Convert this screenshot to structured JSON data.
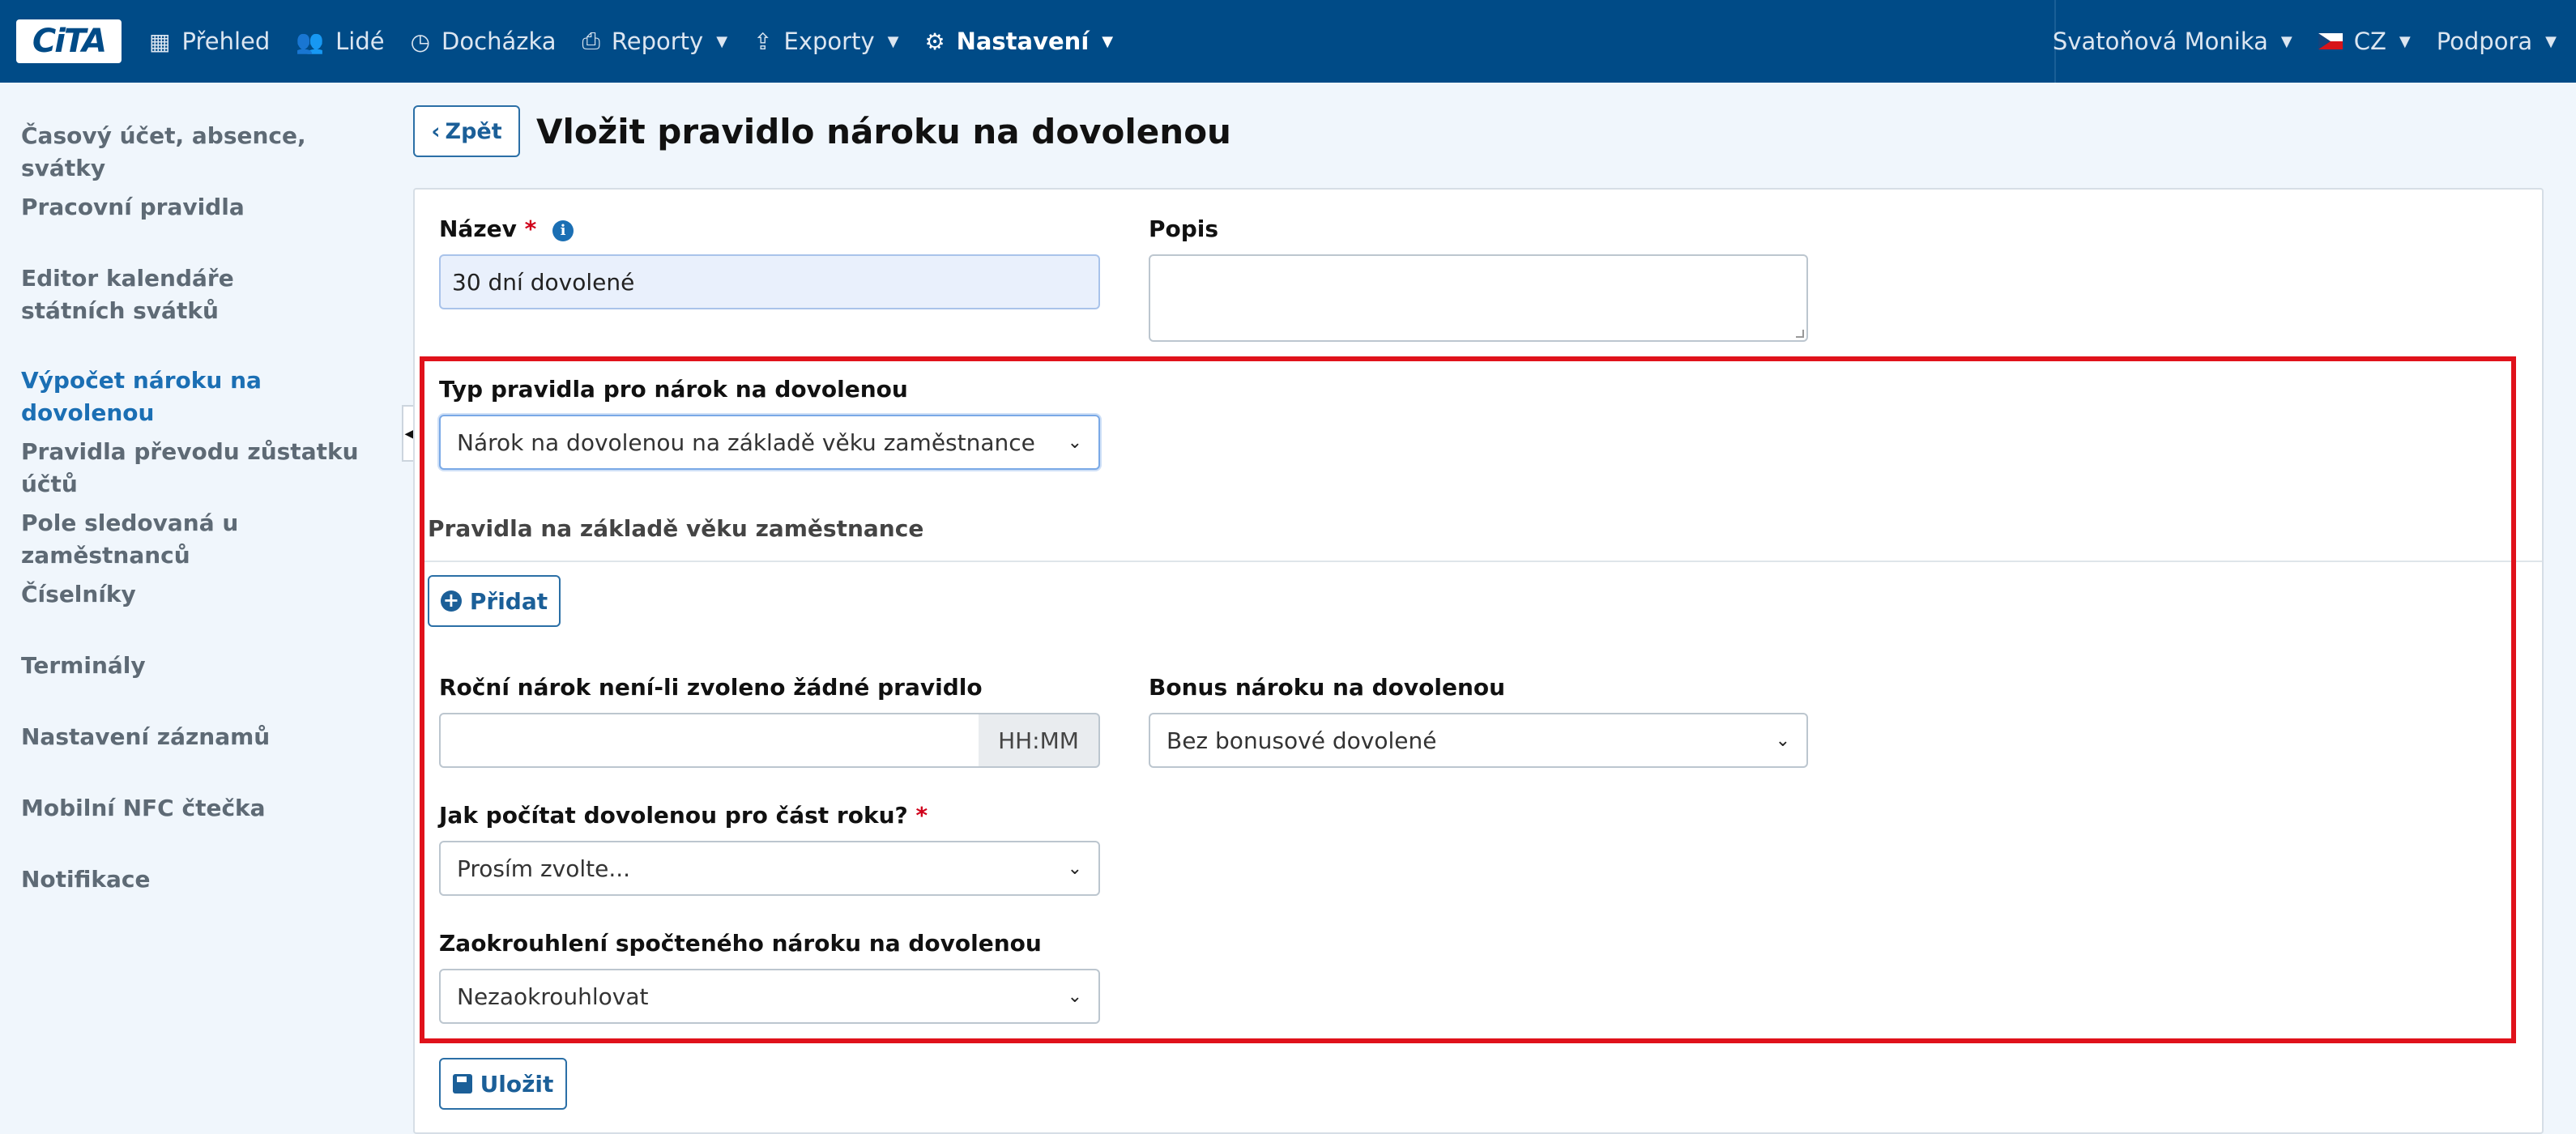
{
  "brand": {
    "logo_text": "CiTA"
  },
  "nav": {
    "items": [
      {
        "label": "Přehled",
        "icon": "grid-icon"
      },
      {
        "label": "Lidé",
        "icon": "users-icon"
      },
      {
        "label": "Docházka",
        "icon": "clock-icon"
      },
      {
        "label": "Reporty",
        "icon": "print-icon"
      },
      {
        "label": "Exporty",
        "icon": "export-icon"
      },
      {
        "label": "Nastavení",
        "icon": "gear-icon"
      }
    ],
    "user": "Svatoňová Monika",
    "language": "CZ",
    "support": "Podpora"
  },
  "sidebar": {
    "items": [
      {
        "label": "Časový účet, absence, svátky"
      },
      {
        "label": "Pracovní pravidla"
      },
      {
        "label": "Editor kalendáře státních svátků"
      },
      {
        "label": "Výpočet nároku na dovolenou",
        "active": true
      },
      {
        "label": "Pravidla převodu zůstatku účtů"
      },
      {
        "label": "Pole sledovaná u zaměstnanců"
      },
      {
        "label": "Číselníky"
      },
      {
        "label": "Terminály"
      },
      {
        "label": "Nastavení záznamů"
      },
      {
        "label": "Mobilní NFC čtečka"
      },
      {
        "label": "Notifikace"
      }
    ]
  },
  "page": {
    "back_label": "Zpět",
    "title": "Vložit pravidlo nároku na dovolenou"
  },
  "form": {
    "name_label": "Název",
    "name_required": "*",
    "name_value": "30 dní dovolené",
    "description_label": "Popis",
    "description_value": "",
    "rule_type_label": "Typ pravidla pro nárok na dovolenou",
    "rule_type_value": "Nárok na dovolenou na základě věku zaměstnance",
    "age_rules_title": "Pravidla na základě věku zaměstnance",
    "add_label": "Přidat",
    "annual_label": "Roční nárok není-li zvoleno žádné pravidlo",
    "annual_value": "",
    "annual_addon": "HH:MM",
    "bonus_label": "Bonus nároku na dovolenou",
    "bonus_value": "Bez bonusové dovolené",
    "partial_label": "Jak počítat dovolenou pro část roku?",
    "partial_required": "*",
    "partial_value": "Prosím zvolte...",
    "rounding_label": "Zaokrouhlení spočteného nároku na dovolenou",
    "rounding_value": "Nezaokrouhlovat",
    "save_label": "Uložit"
  },
  "colors": {
    "navbar": "#004b87",
    "accent": "#1b6fb4",
    "highlight": "#e0121b",
    "required": "#d0021b"
  }
}
